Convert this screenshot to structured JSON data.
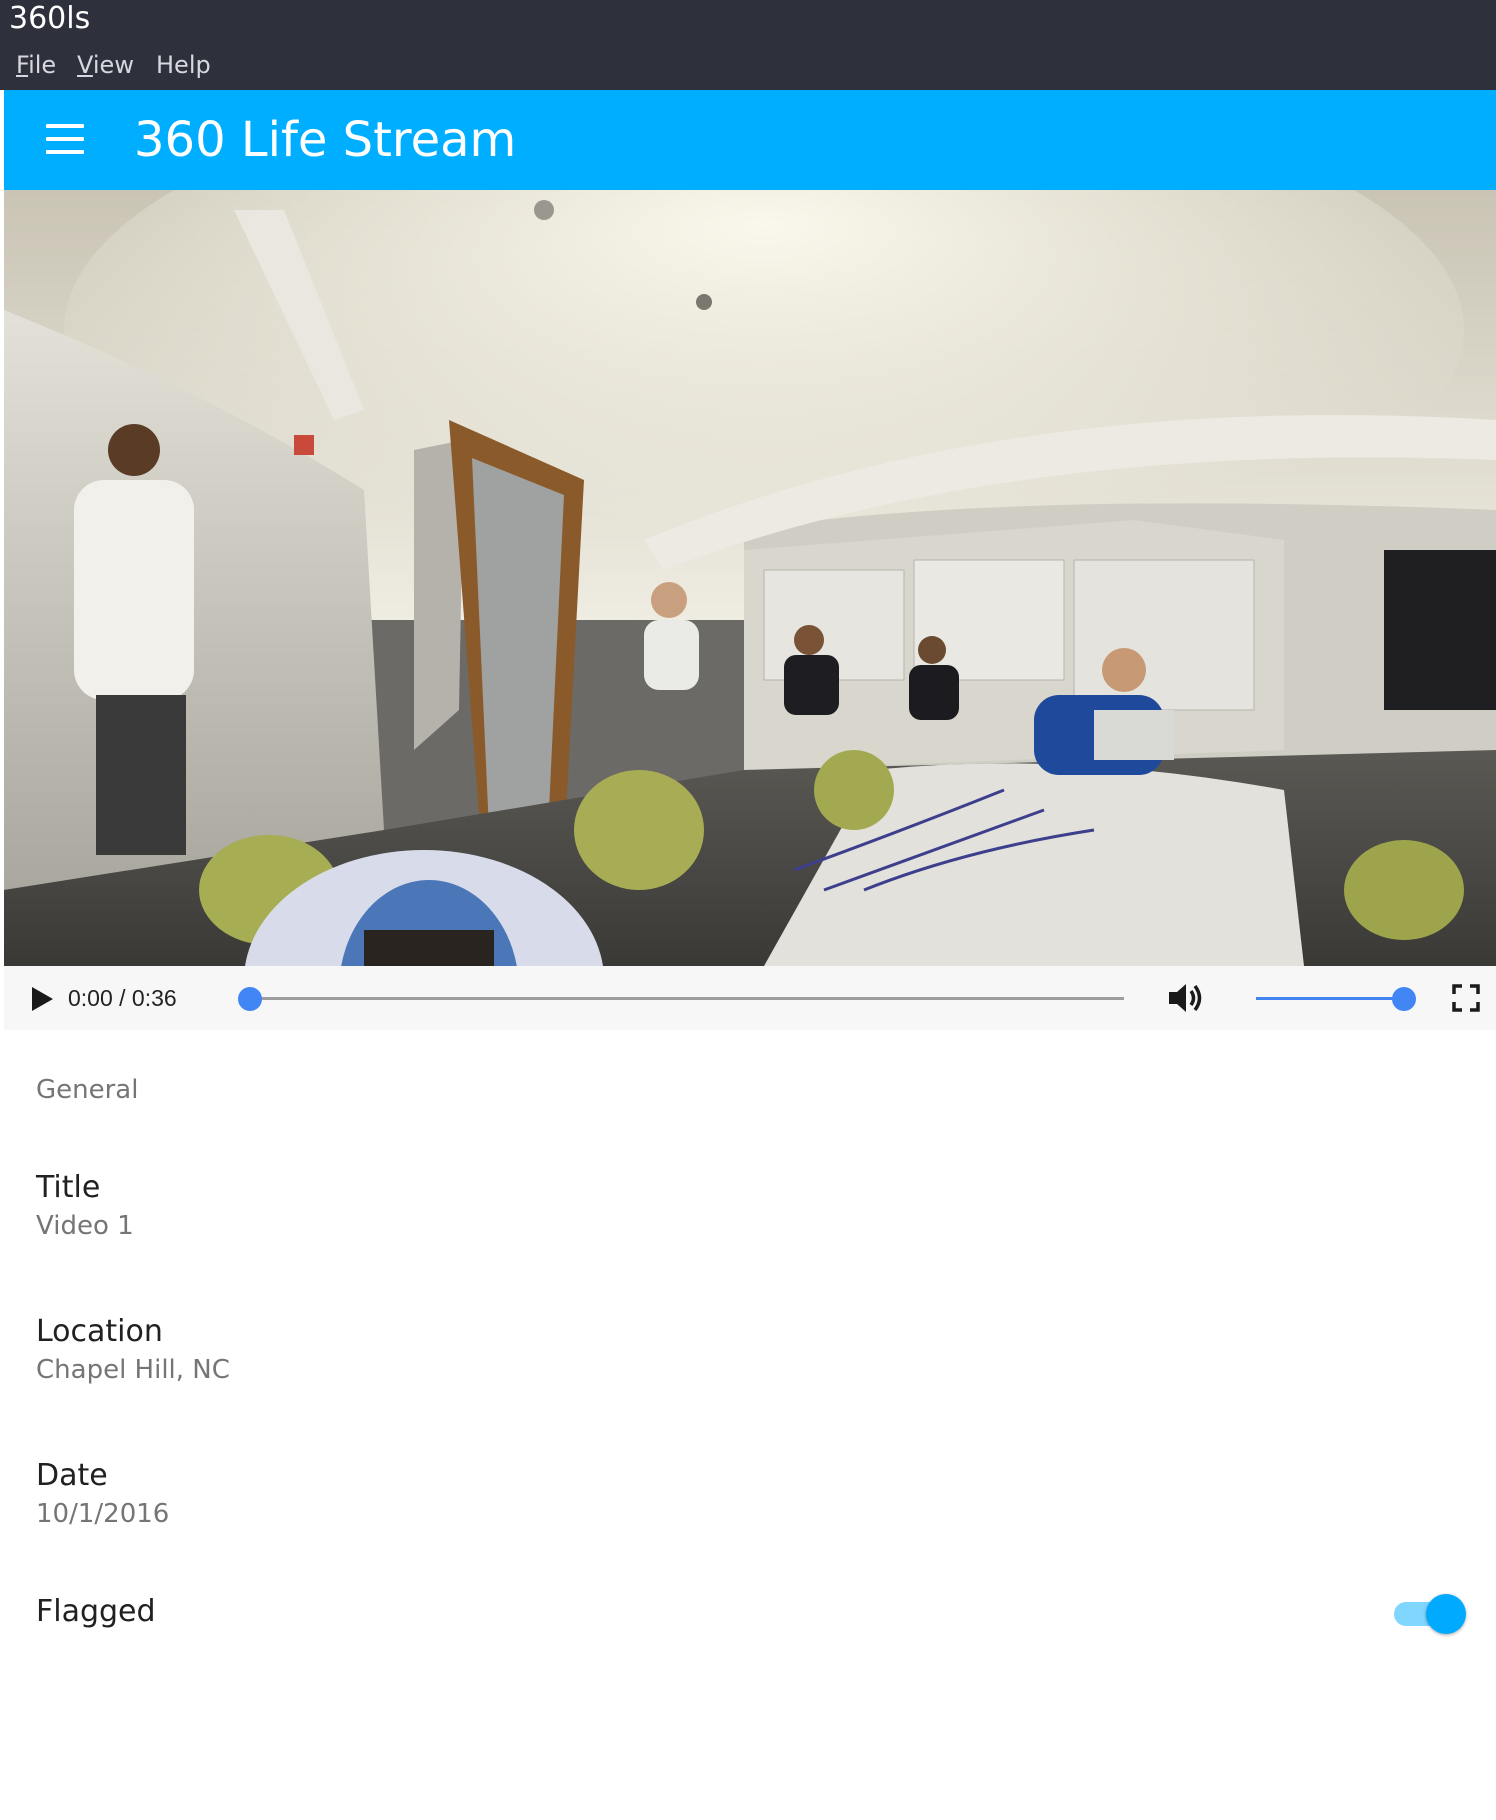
{
  "window": {
    "title": "360ls",
    "menu": [
      {
        "label": "File",
        "mnemonic": "F",
        "rest": "ile"
      },
      {
        "label": "View",
        "mnemonic": "V",
        "rest": "iew"
      },
      {
        "label": "Help",
        "mnemonic": "",
        "rest": "Help"
      }
    ]
  },
  "appbar": {
    "title": "360 Life Stream",
    "menu_icon": "hamburger-menu-icon",
    "color": "#00aeff"
  },
  "player": {
    "time_display": "0:00 / 0:36",
    "progress": 0.0,
    "volume": 1.0,
    "accent": "#4285f4",
    "icons": [
      "play-icon",
      "volume-icon",
      "fullscreen-icon"
    ]
  },
  "details": {
    "section": "General",
    "fields": [
      {
        "label": "Title",
        "value": "Video 1"
      },
      {
        "label": "Location",
        "value": "Chapel Hill, NC"
      },
      {
        "label": "Date",
        "value": "10/1/2016"
      }
    ],
    "flagged": {
      "label": "Flagged",
      "checked": true,
      "color": "#00aaff"
    }
  }
}
